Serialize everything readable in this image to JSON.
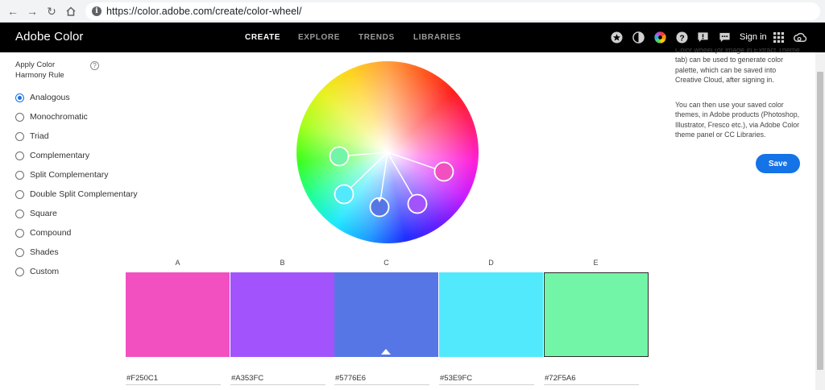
{
  "browser": {
    "url": "https://color.adobe.com/create/color-wheel/",
    "icons": [
      "back-icon",
      "forward-icon",
      "reload-icon",
      "home-icon",
      "site-info-icon"
    ]
  },
  "header": {
    "brand": "Adobe Color",
    "nav": [
      {
        "label": "CREATE",
        "active": true
      },
      {
        "label": "EXPLORE",
        "active": false
      },
      {
        "label": "TRENDS",
        "active": false
      },
      {
        "label": "LIBRARIES",
        "active": false
      }
    ],
    "icons": [
      "star-icon",
      "contrast-icon",
      "color-wheel-icon",
      "help-icon",
      "feedback-icon",
      "chat-icon",
      "apps-grid-icon",
      "creative-cloud-icon"
    ],
    "signin": "Sign in"
  },
  "harmony": {
    "title": "Apply Color Harmony Rule",
    "help_glyph": "?",
    "selected": "Analogous",
    "options": [
      "Analogous",
      "Monochromatic",
      "Triad",
      "Complementary",
      "Split Complementary",
      "Double Split Complementary",
      "Square",
      "Compound",
      "Shades",
      "Custom"
    ]
  },
  "info": {
    "paragraph1": "Color wheel (or image in Extract Theme tab) can be used to generate color palette, which can be saved into Creative Cloud, after signing in.",
    "paragraph2": "You can then use your saved color themes, in Adobe products (Photoshop, Illustrator, Fresco etc.), via Adobe Color theme panel or CC Libraries.",
    "save_label": "Save"
  },
  "swatches": [
    {
      "label": "A",
      "hex": "#F250C1"
    },
    {
      "label": "B",
      "hex": "#A353FC"
    },
    {
      "label": "C",
      "hex": "#5776E6",
      "base": true
    },
    {
      "label": "D",
      "hex": "#53E9FC"
    },
    {
      "label": "E",
      "hex": "#72F5A6",
      "selected": true
    }
  ]
}
